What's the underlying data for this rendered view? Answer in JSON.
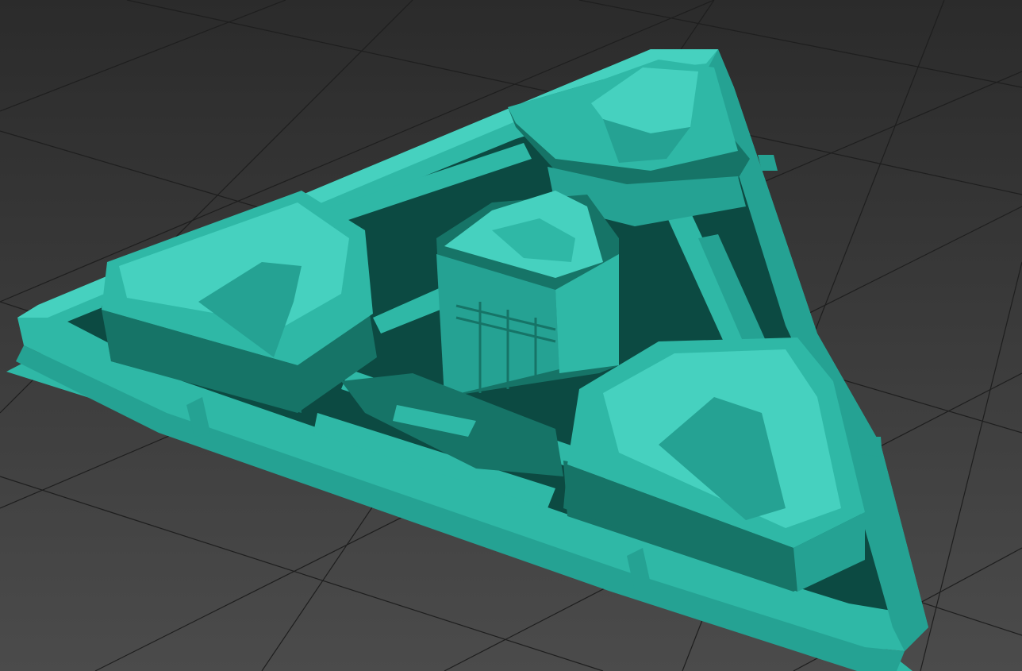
{
  "viewport": {
    "background_top": "#2b2b2b",
    "background_bottom": "#4b4b4b",
    "grid_color": "#1e1e1e"
  },
  "model": {
    "base_color": "#2fb8a6",
    "light_color": "#46d1bf",
    "mid_color": "#25a293",
    "dark_color": "#167467",
    "shadow_color": "#0c4a42"
  }
}
